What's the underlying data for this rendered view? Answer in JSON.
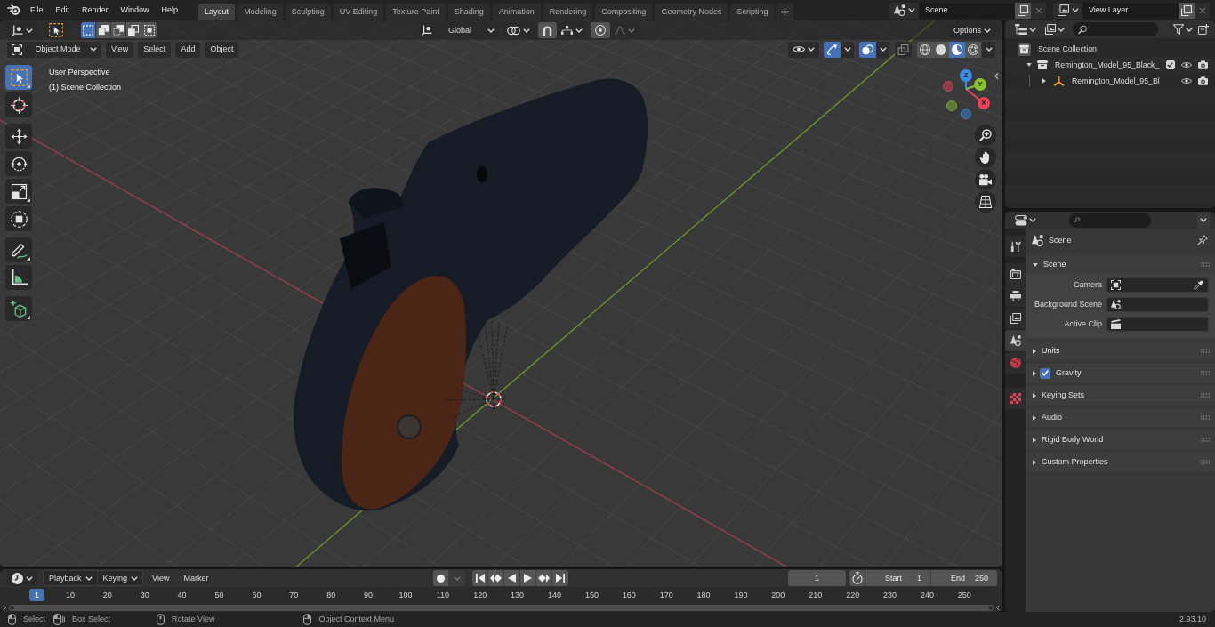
{
  "top_bar": {
    "menus": [
      "File",
      "Edit",
      "Render",
      "Window",
      "Help"
    ],
    "workspaces": [
      {
        "label": "Layout",
        "selected": true
      },
      {
        "label": "Modeling",
        "selected": false
      },
      {
        "label": "Sculpting",
        "selected": false
      },
      {
        "label": "UV Editing",
        "selected": false
      },
      {
        "label": "Texture Paint",
        "selected": false
      },
      {
        "label": "Shading",
        "selected": false
      },
      {
        "label": "Animation",
        "selected": false
      },
      {
        "label": "Rendering",
        "selected": false
      },
      {
        "label": "Compositing",
        "selected": false
      },
      {
        "label": "Geometry Nodes",
        "selected": false
      },
      {
        "label": "Scripting",
        "selected": false
      }
    ],
    "scene": "Scene",
    "view_layer": "View Layer"
  },
  "viewport": {
    "tool_header": {
      "selection_modes": [
        {
          "kind": "set",
          "selected": true
        },
        {
          "kind": "extend",
          "selected": false
        },
        {
          "kind": "subtract",
          "selected": false
        },
        {
          "kind": "difference",
          "selected": false
        },
        {
          "kind": "intersect",
          "selected": false
        }
      ],
      "orientation": "Global",
      "options": "Options"
    },
    "header": {
      "mode": "Object Mode",
      "menus": [
        "View",
        "Select",
        "Add",
        "Object"
      ],
      "toggles": [
        {
          "kind": "gizmos",
          "on": true
        },
        {
          "kind": "overlays",
          "on": true
        },
        {
          "kind": "xray",
          "on": false
        }
      ],
      "shading": [
        {
          "kind": "wireframe",
          "selected": false
        },
        {
          "kind": "solid",
          "selected": false
        },
        {
          "kind": "material",
          "selected": true
        },
        {
          "kind": "rendered",
          "selected": false
        }
      ]
    },
    "overlay_text": [
      "User Perspective",
      "(1) Scene Collection"
    ],
    "tools": [
      {
        "kind": "select_box",
        "selected": true,
        "grouped": true
      },
      {
        "kind": "cursor",
        "selected": false,
        "grouped": false
      },
      {
        "kind": "move",
        "selected": false,
        "grouped": false
      },
      {
        "kind": "rotate",
        "selected": false,
        "grouped": false
      },
      {
        "kind": "scale",
        "selected": false,
        "grouped": true
      },
      {
        "kind": "transform",
        "selected": false,
        "grouped": false
      },
      {
        "kind": "annotate",
        "selected": false,
        "grouped": true
      },
      {
        "kind": "measure",
        "selected": false,
        "grouped": false
      },
      {
        "kind": "add_cube",
        "selected": false,
        "grouped": true
      }
    ],
    "gizmo_axes": [
      {
        "label": "X",
        "color": "#e8435a"
      },
      {
        "label": "Y",
        "color": "#86c232"
      },
      {
        "label": "Z",
        "color": "#3a8ee6"
      }
    ]
  },
  "timeline": {
    "dropdowns": [
      "Playback",
      "Keying"
    ],
    "menus": [
      "View",
      "Marker"
    ],
    "current_frame": "1",
    "start_label": "Start",
    "start": "1",
    "end_label": "End",
    "end": "250",
    "playhead": "1",
    "ruler": [
      "10",
      "20",
      "30",
      "40",
      "50",
      "60",
      "70",
      "80",
      "90",
      "100",
      "110",
      "120",
      "130",
      "140",
      "150",
      "160",
      "170",
      "180",
      "190",
      "200",
      "210",
      "220",
      "230",
      "240",
      "250"
    ]
  },
  "status_bar": {
    "hints": [
      {
        "kind": "left",
        "label": "Select"
      },
      {
        "kind": "left_drag",
        "label": "Box Select"
      },
      {
        "kind": "middle",
        "label": "Rotate View"
      },
      {
        "kind": "right",
        "label": "Object Context Menu"
      }
    ],
    "version": "2.93.10"
  },
  "outliner": {
    "tree": [
      {
        "label": "Scene Collection",
        "kind": "scene_collection",
        "children": [
          {
            "label": "Remington_Model_95_Black_",
            "kind": "collection",
            "expanded": true,
            "checked": true,
            "children": [
              {
                "label": "Remington_Model_95_Bl",
                "kind": "empty",
                "expanded": false
              }
            ]
          }
        ]
      }
    ]
  },
  "properties": {
    "tabs": [
      {
        "kind": "tool",
        "selected": false
      },
      {
        "kind": "render",
        "selected": false
      },
      {
        "kind": "output",
        "selected": false
      },
      {
        "kind": "view_layer",
        "selected": false
      },
      {
        "kind": "scene",
        "selected": true
      },
      {
        "kind": "world",
        "selected": false
      },
      {
        "kind": "texture",
        "selected": false
      }
    ],
    "context": "Scene",
    "panels": [
      {
        "title": "Scene",
        "expanded": true,
        "fields": [
          {
            "label": "Camera",
            "kind": "camera"
          },
          {
            "label": "Background Scene",
            "kind": "scene"
          },
          {
            "label": "Active Clip",
            "kind": "clip"
          }
        ]
      },
      {
        "title": "Units",
        "expanded": false
      },
      {
        "title": "Gravity",
        "expanded": false,
        "checked": true
      },
      {
        "title": "Keying Sets",
        "expanded": false
      },
      {
        "title": "Audio",
        "expanded": false
      },
      {
        "title": "Rigid Body World",
        "expanded": false
      },
      {
        "title": "Custom Properties",
        "expanded": false
      }
    ]
  }
}
